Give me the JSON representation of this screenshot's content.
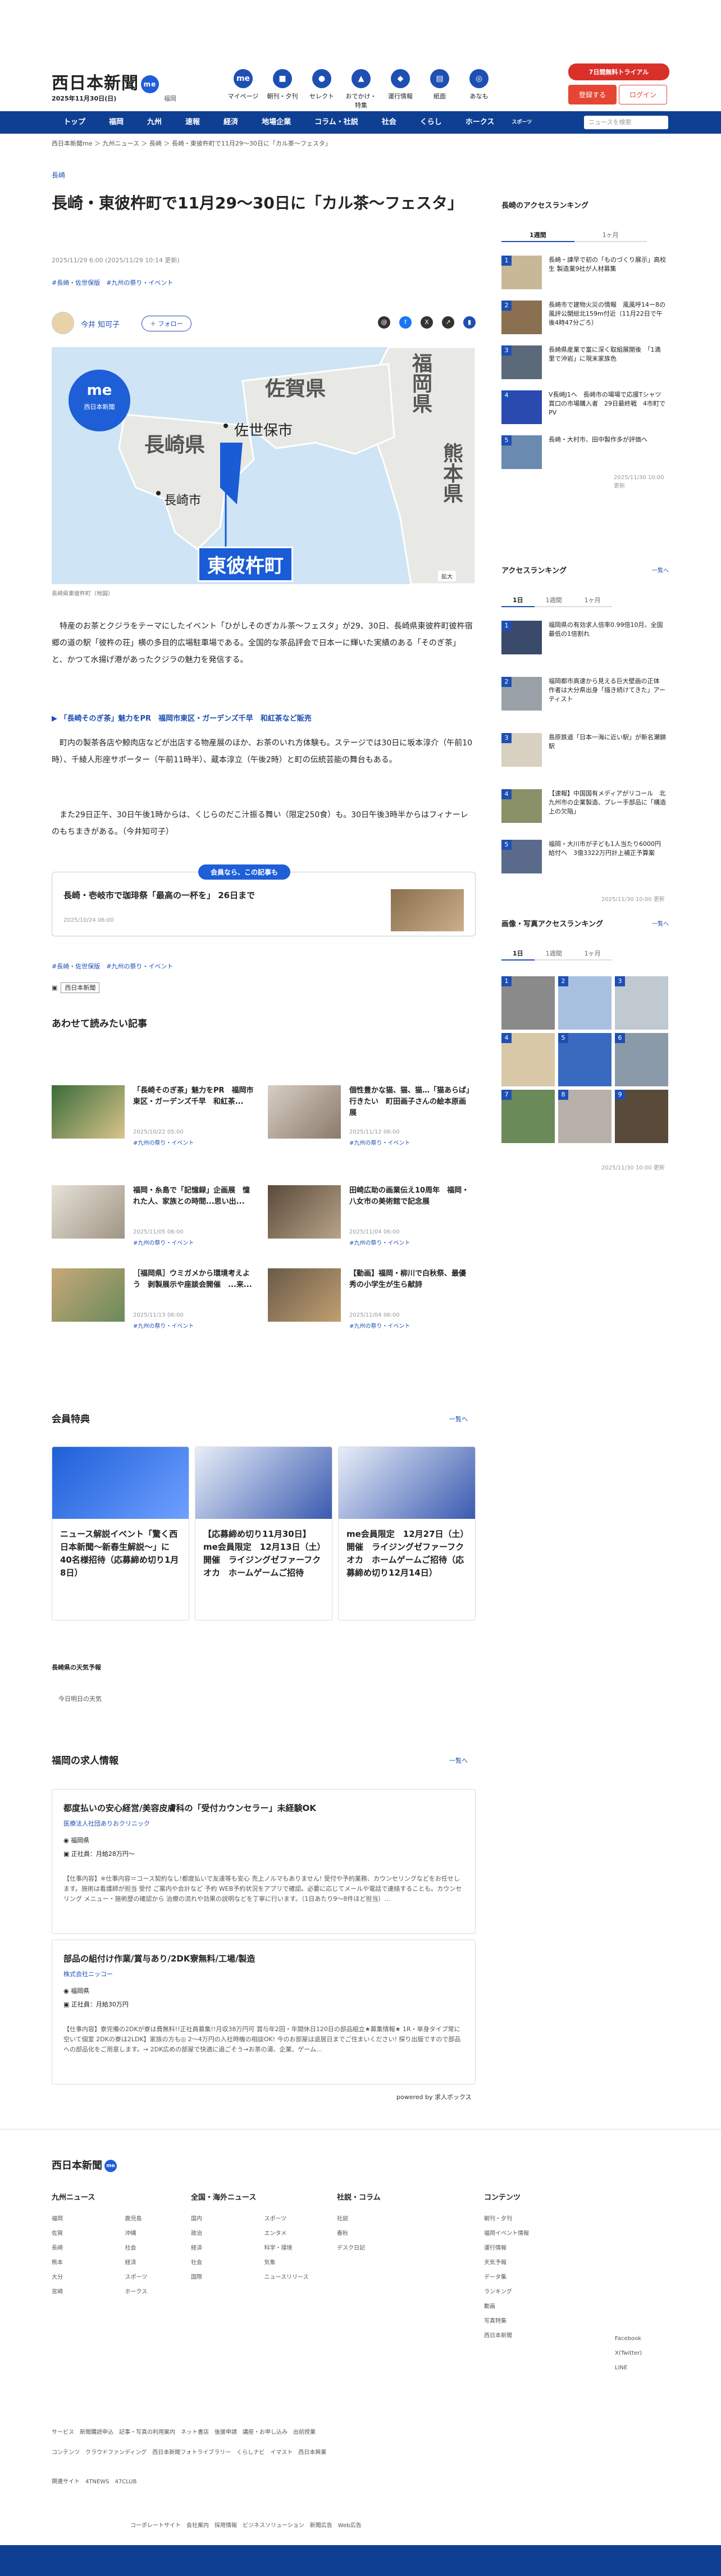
{
  "header": {
    "logo": "西日本新聞",
    "logo_badge": "me",
    "date": "2025年11月30日(日)",
    "place": "福岡",
    "icons": [
      {
        "label": "マイページ",
        "icon": "me"
      },
      {
        "label": "朝刊・夕刊",
        "icon": "newspaper-icon"
      },
      {
        "label": "セレクト",
        "icon": "select-icon"
      },
      {
        "label": "おでかけ・特集",
        "icon": "walk-icon"
      },
      {
        "label": "運行情報",
        "icon": "train-icon"
      },
      {
        "label": "紙面",
        "icon": "paper-icon"
      },
      {
        "label": "あなも",
        "icon": "anamo-icon"
      }
    ],
    "trial": "7日間無料トライアル",
    "register": "登録する",
    "login": "ログイン"
  },
  "nav": {
    "items": [
      "トップ",
      "福岡",
      "九州",
      "速報",
      "経済",
      "地場企業",
      "コラム・社説",
      "社会",
      "くらし",
      "ホークス",
      "スポーツ"
    ],
    "search_placeholder": "ニュースを検索"
  },
  "breadcrumb": "西日本新聞me ＞ 九州ニュース ＞ 長崎 ＞ 長崎・東彼杵町で11月29〜30日に「カル茶〜フェスタ」",
  "article": {
    "category": "長崎",
    "title": "長崎・東彼杵町で11月29〜30日に「カル茶〜フェスタ」",
    "date": "2025/11/29 6:00 (2025/11/29 10:14 更新)",
    "tags": "#長崎・佐世保版　#九州の祭り・イベント",
    "author": "今井 知可子",
    "follow": "＋ フォロー",
    "map_labels": {
      "brand": "西日本新聞",
      "fukuoka": "福岡県",
      "saga": "佐賀県",
      "nagasaki": "長崎県",
      "sasebo": "佐世保市",
      "kumamoto": "熊本県",
      "nagasaki_city": "長崎市",
      "town": "東彼杵町",
      "zoom": "拡大"
    },
    "caption": "長崎県東彼杵町（地図）",
    "p1": "特産のお茶とクジラをテーマにしたイベント「ひがしそのぎカル茶〜フェスタ」が29、30日、長崎県東彼杵町彼杵宿郷の道の駅「彼杵の荘」横の多目的広場駐車場である。全国的な茶品評会で日本一に輝いた実績のある「そのぎ茶」と、かつて水揚げ港があったクジラの魅力を発信する。",
    "link": "「長崎そのぎ茶」魅力をPR　福岡市東区・ガーデンズ千早　和紅茶など販売",
    "p2": "町内の製茶各店や鯨肉店などが出店する物産展のほか、お茶のいれ方体験も。ステージでは30日に坂本淳介（午前10時）、千綾人形座サポーター（午前11時半）、蔵本淳立（午後2時）と町の伝統芸能の舞台もある。",
    "p3": "また29日正午、30日午後1時からは、くじらのだこ汁振る舞い（限定250食）も。30日午後3時半からはフィナーレのもちまきがある。（今井知可子）",
    "member_label": "会員なら、この記事も",
    "member_title": "長崎・壱岐市で珈琲祭「最高の一杯を」 26日まで",
    "member_date": "2025/10/24 06:00",
    "tags2": "#長崎・佐世保版　#九州の祭り・イベント",
    "source": "西日本新聞"
  },
  "related": {
    "title": "あわせて読みたい記事",
    "items": [
      {
        "title": "「長崎そのぎ茶」魅力をPR　福岡市東区・ガーデンズ千早　和紅茶...",
        "meta": "2025/10/22 05:00",
        "tag": "#九州の祭り・イベント"
      },
      {
        "title": "個性豊かな猫、猫、猫…「猫あらば」行きたい　町田画子さんの絵本原画展",
        "meta": "2025/11/12 06:00",
        "tag": "#九州の祭り・イベント"
      },
      {
        "title": "福岡・糸島で「記憶録」企画展　憧れた人、家族との時間...思い出...",
        "meta": "2025/11/05 06:00",
        "tag": "#九州の祭り・イベント"
      },
      {
        "title": "田崎広助の画業伝え10周年　福岡・八女市の美術館で記念展",
        "meta": "2025/11/04 06:00",
        "tag": "#九州の祭り・イベント"
      },
      {
        "title": "［福岡県］ウミガメから環境考えよう　剥製展示や座談会開催　...来...",
        "meta": "2025/11/13 06:00",
        "tag": "#九州の祭り・イベント"
      },
      {
        "title": "【動画】福岡・柳川で白秋祭、最優秀の小学生が生ら献詩",
        "meta": "2025/11/04 06:00",
        "tag": "#九州の祭り・イベント"
      }
    ]
  },
  "benefits": {
    "title": "会員特典",
    "more": "一覧へ",
    "items": [
      {
        "title": "ニュース解説イベント「驚く西日本新聞〜新春生解説〜」に40名様招待（応募締め切り1月8日）"
      },
      {
        "title": "【応募締め切り11月30日】me会員限定　12月13日（土）開催　ライジングゼファーフクオカ　ホームゲームご招待"
      },
      {
        "title": "me会員限定　12月27日（土）開催　ライジングゼファーフクオカ　ホームゲームご招待（応募締め切り12月14日）"
      }
    ]
  },
  "weather": {
    "title": "長崎県の天気予報",
    "item": "今日明日の天気"
  },
  "jobs": {
    "title": "福岡の求人情報",
    "more": "一覧へ",
    "items": [
      {
        "title": "都度払いの安心経営/美容皮膚科の「受付カウンセラー」未経験OK",
        "company": "医療法人社団ありおクリニック",
        "location": "福岡県",
        "salary": "正社員：月給28万円〜",
        "desc": "【仕事内容】※仕事内容＝コース契約なし!都度払いで友達等も安心 売上ノルマもありません! 受付や予約業務、カウンセリングなどをお任せします。施術は看護師が担当 受付 ご案内や会計など 予約 WEB予約状況をアプリで確認。必要に応じてメールや電話で連絡することも。カウンセリング メニュー・施術歴の確認から 治療の流れや効果の説明などを丁寧に行います。（1日あたり9〜8件ほど担当）..."
      },
      {
        "title": "部品の組付け作業/賞与あり/2DK寮無料/工場/製造",
        "company": "株式会社ニッコー",
        "location": "福岡県",
        "salary": "正社員：月給30万円",
        "desc": "【仕事内容】寮完備の2DKが寮は費無料!!正社員募集!!月収38万円可 賞与年2回・年間休日120日の部品組立★募集情報★ 1R・単身タイプ常に空いて個室 2DKの寮は2LDK】家族の方も◎ 2〜4万円の入社時機の相談OK! 今のお部屋は退居日までご住まいください! 探り出版ですので部品への部品化をご用意します。→ 2DK広めの部屋で快適に過ごそう→お茶の湯、企業、ゲーム..."
      }
    ],
    "powered": "powered by 求人ボックス"
  },
  "sidebar": {
    "access_title": "長崎のアクセスランキング",
    "tabs1": [
      "1週間",
      "1ヶ月"
    ],
    "rank1": [
      "長崎・諫早で初の「ものづくり展示」高校生 製造業9社が人材募集",
      "長崎市で建物火災の情報　風風呼14ー8の風評公開総北159m付近（11月22日で午後4時47分ごろ）",
      "長崎県産業で富に深く取組展開後　「1満里で沖岩」に現末家族色",
      "V長崎J1へ　長崎市の場場で応援Tシャツ　賞口の市場購入者　29日最終戦　4市町でPV",
      "長崎・大村市、田中製作多が評価へ"
    ],
    "ts1": "2025/11/30 10:00 更新",
    "access2_title": "アクセスランキング",
    "access2_more": "一覧へ",
    "tabs2": [
      "1日",
      "1週間",
      "1ヶ月"
    ],
    "rank2": [
      "福岡県の有効求人倍率0.99倍10月、全国最低の1倍割れ",
      "福岡都市高速から見える巨大壁画の正体　作者は大分県出身「描き続けてきた」アーティスト",
      "島原鉄道「日本一海に近い駅」が新名瀬錦駅",
      "【速報】中国国有メディアがリコール　北九州市の企業製造、プレー手部品に「構造上の欠陥」",
      "福岡・大川市が子ども1人当たり6000円給付へ　3億3322万円計上補正予算案"
    ],
    "ts2": "2025/11/30 10:00 更新",
    "photo_title": "画像・写真アクセスランキング",
    "photo_more": "一覧へ",
    "tabs3": [
      "1日",
      "1週間",
      "1ヶ月"
    ],
    "ts3": "2025/11/30 10:00 更新"
  },
  "footer": {
    "logo": "西日本新聞",
    "cols": [
      {
        "title": "九州ニュース",
        "items": [
          "福岡",
          "佐賀",
          "長崎",
          "熊本",
          "大分",
          "宮崎",
          "鹿児島",
          "沖縄",
          "社会",
          "経済",
          "スポーツ",
          "ホークス"
        ]
      },
      {
        "title": "全国・海外ニュース",
        "items": [
          "国内",
          "政治",
          "経済",
          "社会",
          "国際",
          "スポーツ",
          "エンタメ",
          "科学・環境",
          "気象",
          "ニュースリリース"
        ]
      },
      {
        "title": "社説・コラム",
        "items": [
          "社説",
          "春秋",
          "デスク日記"
        ]
      },
      {
        "title": "コンテンツ",
        "items": [
          "朝刊・夕刊",
          "福岡イベント情報",
          "運行情報",
          "天気予報",
          "データ集",
          "ランキング",
          "動画",
          "写真特集",
          "西日本新聞"
        ]
      }
    ],
    "service": "サービス　新聞購読申込　記事・写真の利用案内　ネット書店　後援申請　講座・お申し込み　出前授業",
    "content": "コンテンツ　クラウドファンディング　西日本新聞フォトライブラリー　くらしナビ　イマスト　西日本興業",
    "group": "関連サイト　4TNEWS　47CLUB",
    "bottom": "コーポレートサイト　会社案内　採用情報　ビジネスソリューション　新聞広告　Web広告",
    "social": [
      "Facebook",
      "X(Twitter)",
      "LINE"
    ]
  }
}
